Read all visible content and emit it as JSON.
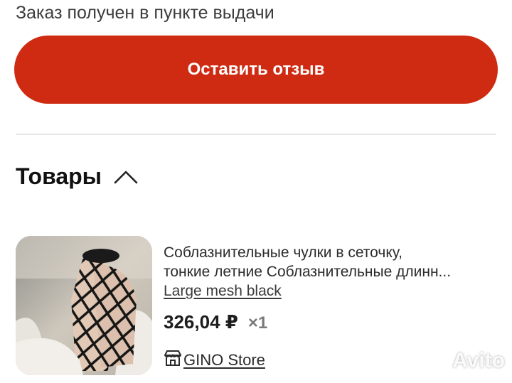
{
  "order": {
    "status_text": "Заказ получен в пункте выдачи"
  },
  "actions": {
    "review_button_label": "Оставить отзыв",
    "accent_color": "#cf2b12"
  },
  "products_section": {
    "title": "Товары",
    "expanded": true,
    "toggle_icon": "chevron-up-icon"
  },
  "products": [
    {
      "title_line1": "Соблазнительные чулки в сеточку,",
      "title_line2": "тонкие летние Соблазнительные длинн...",
      "variant": "Large mesh black",
      "price": "326,04 ₽",
      "quantity": "×1",
      "store": "GINO Store",
      "store_icon": "store-icon"
    }
  ],
  "watermark": {
    "text": "Avito"
  }
}
